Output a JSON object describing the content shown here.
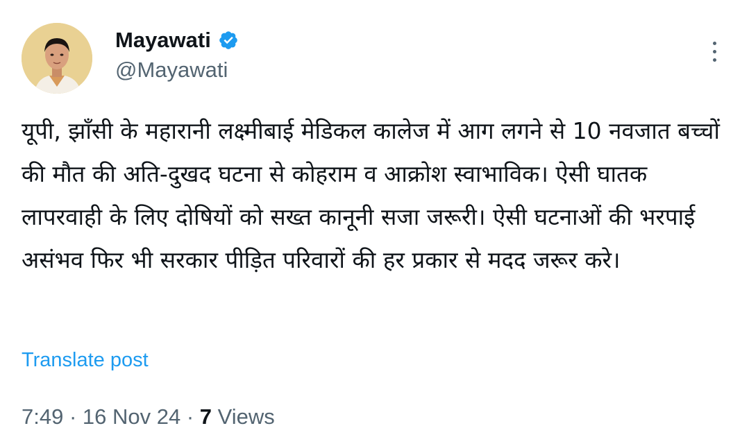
{
  "author": {
    "name": "Mayawati",
    "handle": "@Mayawati",
    "avatar": "profile-photo",
    "verified_icon": "verified-badge-icon",
    "verified_color": "#1d9bf0"
  },
  "menu": {
    "icon": "more-vertical-icon"
  },
  "tweet": {
    "text": "यूपी, झाँसी के महारानी लक्ष्मीबाई मेडिकल कालेज में आग लगने से 10 नवजात बच्चों की मौत की अति-दुखद घटना से कोहराम व आक्रोश स्वाभाविक। ऐसी घातक लापरवाही के लिए दोषियों को सख्त कानूनी सजा जरूरी। ऐसी घटनाओं की भरपाई असंभव फिर भी सरकार पीड़ित परिवारों की हर प्रकार से मदद जरूर करे।"
  },
  "translate_label": "Translate post",
  "meta": {
    "time": "7:49",
    "separator": " · ",
    "date": "16 Nov 24",
    "views_count": "7",
    "views_label": " Views"
  },
  "colors": {
    "text": "#0f1419",
    "secondary": "#536471",
    "link": "#1d9bf0"
  }
}
